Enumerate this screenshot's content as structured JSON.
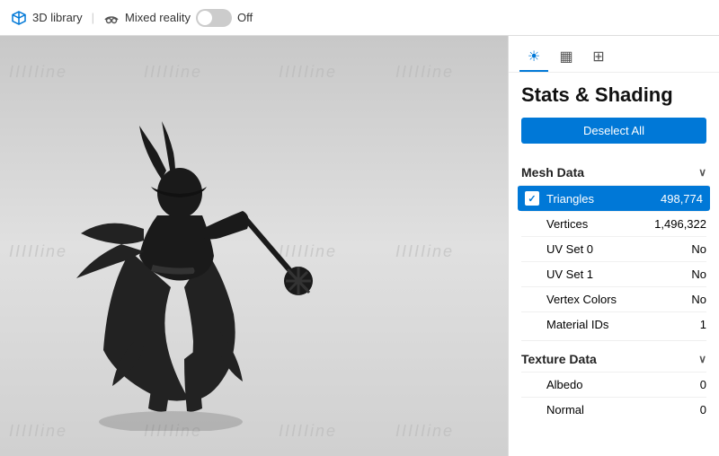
{
  "topbar": {
    "library_label": "3D library",
    "mixed_reality_label": "Mixed reality",
    "toggle_label": "Off"
  },
  "viewport": {
    "watermarks": [
      "IIIIIine",
      "IIIIIine",
      "IIIIIine",
      "IIIIIine",
      "IIIIIine",
      "IIIIIine",
      "IIIIIine",
      "IIIIIine",
      "IIIIIine",
      "IIIIIine",
      "IIIIIine",
      "IIIIIine"
    ]
  },
  "panel": {
    "title": "Stats & Shading",
    "deselect_btn": "Deselect All",
    "tabs": [
      {
        "name": "sun-tab",
        "icon": "☀",
        "active": true
      },
      {
        "name": "grid-tab",
        "icon": "▦",
        "active": false
      },
      {
        "name": "grid2-tab",
        "icon": "⊞",
        "active": false
      }
    ],
    "mesh_data": {
      "header": "Mesh Data",
      "rows": [
        {
          "label": "Triangles",
          "value": "498,774",
          "highlighted": true,
          "checkbox": true
        },
        {
          "label": "Vertices",
          "value": "1,496,322",
          "highlighted": false
        },
        {
          "label": "UV Set 0",
          "value": "No",
          "highlighted": false
        },
        {
          "label": "UV Set 1",
          "value": "No",
          "highlighted": false
        },
        {
          "label": "Vertex Colors",
          "value": "No",
          "highlighted": false
        },
        {
          "label": "Material IDs",
          "value": "1",
          "highlighted": false
        }
      ]
    },
    "texture_data": {
      "header": "Texture Data",
      "rows": [
        {
          "label": "Albedo",
          "value": "0",
          "highlighted": false
        },
        {
          "label": "Normal",
          "value": "0",
          "highlighted": false
        }
      ]
    }
  }
}
